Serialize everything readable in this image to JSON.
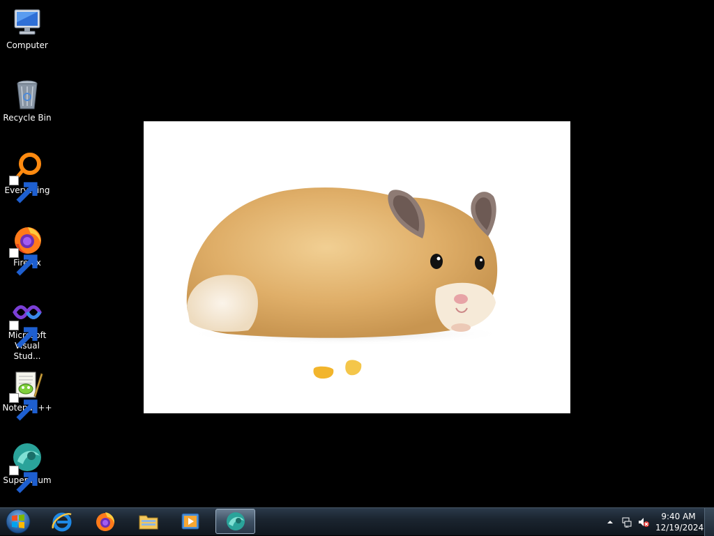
{
  "desktop": {
    "icons": [
      {
        "label": "Computer",
        "icon": "computer-icon"
      },
      {
        "label": "Recycle Bin",
        "icon": "recycle-bin-icon"
      },
      {
        "label": "Everything",
        "icon": "everything-icon",
        "shortcut": true
      },
      {
        "label": "Firefox",
        "icon": "firefox-icon",
        "shortcut": true
      },
      {
        "label": "Microsoft Visual Stud...",
        "icon": "visual-studio-icon",
        "shortcut": true
      },
      {
        "label": "Notepad++",
        "icon": "notepad-plus-plus-icon",
        "shortcut": true
      },
      {
        "label": "Supermium",
        "icon": "supermium-icon",
        "shortcut": true
      }
    ],
    "wallpaper": {
      "subject": "hamster-photo"
    }
  },
  "taskbar": {
    "start_icon": "windows-start-orb-icon",
    "pinned": [
      {
        "icon": "internet-explorer-icon"
      },
      {
        "icon": "firefox-icon"
      },
      {
        "icon": "file-explorer-icon"
      },
      {
        "icon": "media-player-icon"
      },
      {
        "icon": "supermium-icon",
        "active": true
      }
    ],
    "tray": {
      "icons": [
        "show-hidden-icons-icon",
        "network-icon",
        "volume-muted-icon"
      ],
      "time": "9:40 AM",
      "date": "12/19/2024"
    }
  },
  "colors": {
    "desktop_background": "#000000",
    "taskbar": "#1b2530",
    "photo_background": "#ffffff"
  }
}
